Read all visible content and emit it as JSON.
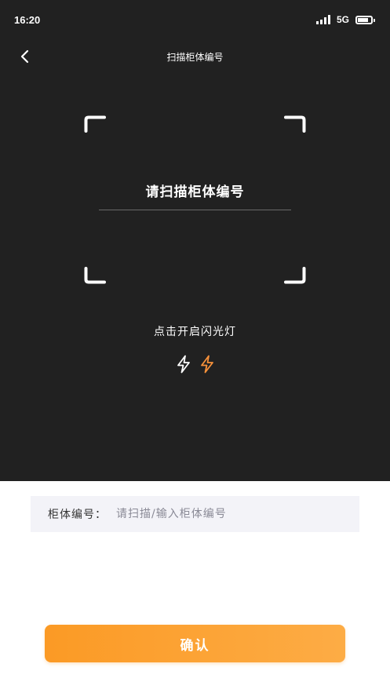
{
  "status_bar": {
    "time": "16:20",
    "network": "5G",
    "icons": [
      "signal-icon",
      "battery-icon"
    ]
  },
  "nav": {
    "title": "扫描柜体编号",
    "back_icon": "chevron-left-icon"
  },
  "scanner": {
    "prompt": "请扫描柜体编号",
    "flash_hint": "点击开启闪光灯",
    "flash_icons": [
      "flash-off-icon",
      "flash-on-icon"
    ],
    "frame_color": "#ffffff",
    "background_color": "#212121"
  },
  "form": {
    "label": "柜体编号：",
    "placeholder": "请扫描/输入柜体编号",
    "value": ""
  },
  "confirm": {
    "label": "确认",
    "color_start": "#fb9a25",
    "color_end": "#fdac45"
  },
  "colors": {
    "accent": "#f7913a",
    "input_bg": "#f3f3f8"
  }
}
